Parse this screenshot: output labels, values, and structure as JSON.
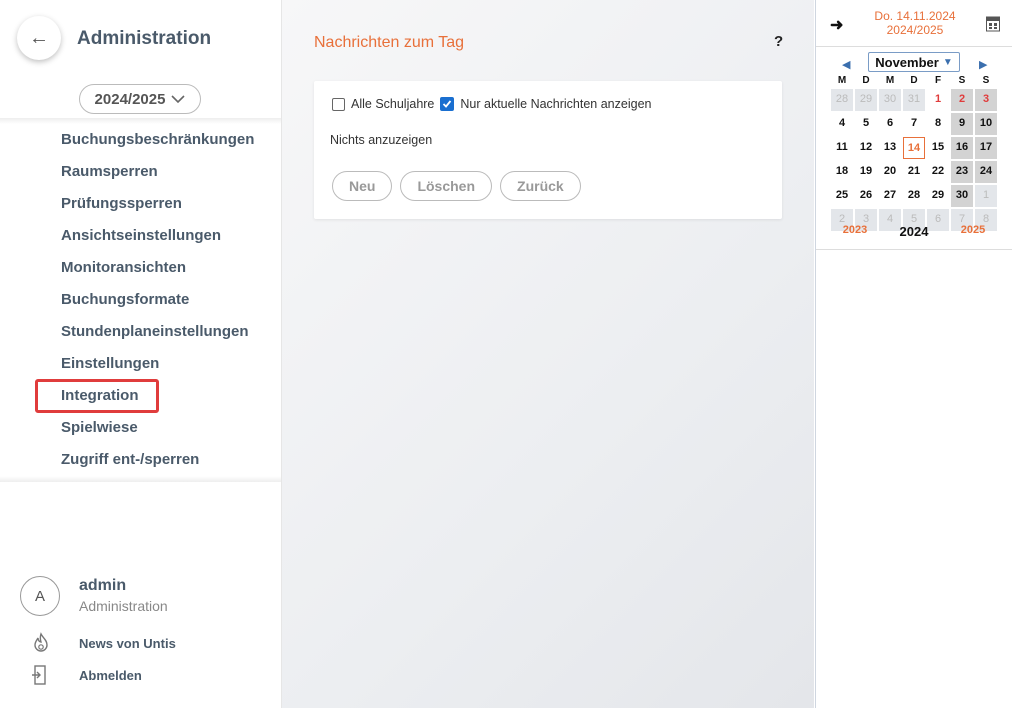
{
  "sidebar": {
    "title": "Administration",
    "school_year": "2024/2025",
    "nav_items": [
      {
        "label": "Buchungsbeschränkungen"
      },
      {
        "label": "Raumsperren"
      },
      {
        "label": "Prüfungssperren"
      },
      {
        "label": "Ansichtseinstellungen"
      },
      {
        "label": "Monitoransichten"
      },
      {
        "label": "Buchungsformate"
      },
      {
        "label": "Stundenplaneinstellungen"
      },
      {
        "label": "Einstellungen"
      },
      {
        "label": "Integration"
      },
      {
        "label": "Spielwiese"
      },
      {
        "label": "Zugriff ent-/sperren"
      }
    ],
    "selected_item": "Integration",
    "user": {
      "initial": "A",
      "name": "admin",
      "role": "Administration"
    },
    "news_label": "News von Untis",
    "logout_label": "Abmelden"
  },
  "main": {
    "title": "Nachrichten zum Tag",
    "help": "?",
    "checkbox_all_years": {
      "label": "Alle Schuljahre",
      "checked": false
    },
    "checkbox_current_only": {
      "label": "Nur aktuelle Nachrichten anzeigen",
      "checked": true
    },
    "empty_text": "Nichts anzuzeigen",
    "buttons": {
      "new": "Neu",
      "delete": "Löschen",
      "back": "Zurück"
    }
  },
  "calendar": {
    "date_line": "Do. 14.11.2024",
    "year_line": "2024/2025",
    "month": "November",
    "weekdays": [
      "M",
      "D",
      "M",
      "D",
      "F",
      "S",
      "S"
    ],
    "weeks": [
      [
        "28",
        "29",
        "30",
        "31",
        "1",
        "2",
        "3"
      ],
      [
        "4",
        "5",
        "6",
        "7",
        "8",
        "9",
        "10"
      ],
      [
        "11",
        "12",
        "13",
        "14",
        "15",
        "16",
        "17"
      ],
      [
        "18",
        "19",
        "20",
        "21",
        "22",
        "23",
        "24"
      ],
      [
        "25",
        "26",
        "27",
        "28",
        "29",
        "30",
        "1"
      ],
      [
        "2",
        "3",
        "4",
        "5",
        "6",
        "7",
        "8"
      ]
    ],
    "today": "14",
    "holidays": [
      "1",
      "2",
      "3"
    ],
    "prev_year": "2023",
    "current_year": "2024",
    "next_year": "2025",
    "colors": {
      "accent": "#e8703a",
      "holiday": "#e03c3c",
      "weekend_bg": "#d3d3d3"
    }
  }
}
